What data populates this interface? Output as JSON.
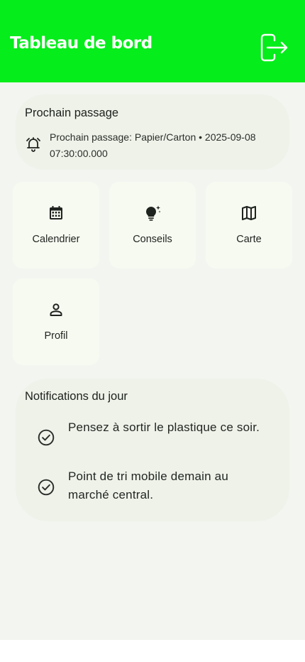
{
  "header": {
    "title": "Tableau de bord",
    "logout_icon": "logout-icon",
    "background_color": "#05ed1a"
  },
  "next_pickup": {
    "title": "Prochain passage",
    "icon": "alarm-bell-icon",
    "text": "Prochain passage: Papier/Carton • 2025-09-08 07:30:00.000"
  },
  "tiles": [
    {
      "label": "Calendrier",
      "icon": "calendar-icon"
    },
    {
      "label": "Conseils",
      "icon": "lightbulb-sparkle-icon"
    },
    {
      "label": "Carte",
      "icon": "map-icon"
    },
    {
      "label": "Profil",
      "icon": "person-icon"
    }
  ],
  "notifications": {
    "title": "Notifications du jour",
    "items": [
      {
        "text": "Pensez à sortir le plastique ce soir.",
        "icon": "check-circle-icon"
      },
      {
        "text": "Point de tri mobile demain au marché central.",
        "icon": "check-circle-icon"
      }
    ]
  }
}
